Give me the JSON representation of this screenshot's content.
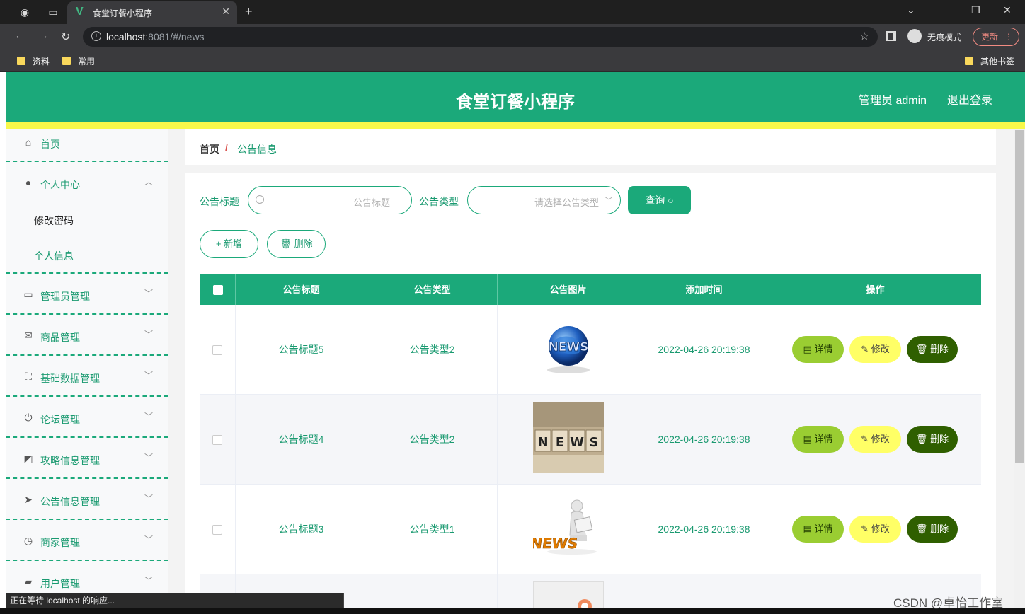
{
  "browser": {
    "tab_title": "食堂订餐小程序",
    "url_host": "localhost",
    "url_rest": ":8081/#/news",
    "incognito_label": "无痕模式",
    "update_label": "更新",
    "bookmarks": [
      "资料",
      "常用"
    ],
    "other_bookmarks": "其他书签",
    "status_text": "正在等待 localhost 的响应..."
  },
  "header": {
    "title": "食堂订餐小程序",
    "user": "管理员 admin",
    "logout": "退出登录"
  },
  "sidebar": {
    "items": [
      {
        "label": "首页",
        "icon": "home-icon"
      },
      {
        "label": "个人中心",
        "icon": "user-icon"
      },
      {
        "label": "管理员管理",
        "icon": "card-icon"
      },
      {
        "label": "商品管理",
        "icon": "mail-icon"
      },
      {
        "label": "基础数据管理",
        "icon": "frame-icon"
      },
      {
        "label": "论坛管理",
        "icon": "power-icon"
      },
      {
        "label": "攻略信息管理",
        "icon": "chart-icon"
      },
      {
        "label": "公告信息管理",
        "icon": "send-icon"
      },
      {
        "label": "商家管理",
        "icon": "clock-icon"
      },
      {
        "label": "用户管理",
        "icon": "wallet-icon"
      }
    ],
    "sub_items": [
      "修改密码",
      "个人信息"
    ]
  },
  "breadcrumb": {
    "home": "首页",
    "separator": "/",
    "current": "公告信息"
  },
  "filters": {
    "title_label": "公告标题",
    "title_placeholder": "公告标题",
    "type_label": "公告类型",
    "type_placeholder": "请选择公告类型",
    "query_label": "查询"
  },
  "actions": {
    "add_label": "新增",
    "delete_label": "删除"
  },
  "table": {
    "columns": [
      "公告标题",
      "公告类型",
      "公告图片",
      "添加时间",
      "操作"
    ],
    "rows": [
      {
        "title": "公告标题5",
        "type": "公告类型2",
        "image": "news-globe",
        "time": "2022-04-26 20:19:38"
      },
      {
        "title": "公告标题4",
        "type": "公告类型2",
        "image": "news-blocks",
        "time": "2022-04-26 20:19:38"
      },
      {
        "title": "公告标题3",
        "type": "公告类型1",
        "image": "news-reader",
        "time": "2022-04-26 20:19:38"
      }
    ],
    "row_buttons": {
      "detail": "详情",
      "edit": "修改",
      "delete": "删除"
    }
  },
  "colors": {
    "primary": "#1ba97a",
    "header_strip": "#f8f84a",
    "detail_btn": "#9acd32",
    "edit_btn": "#ffff66",
    "delete_btn": "#2f5f00"
  },
  "watermark": "CSDN @卓怡工作室"
}
